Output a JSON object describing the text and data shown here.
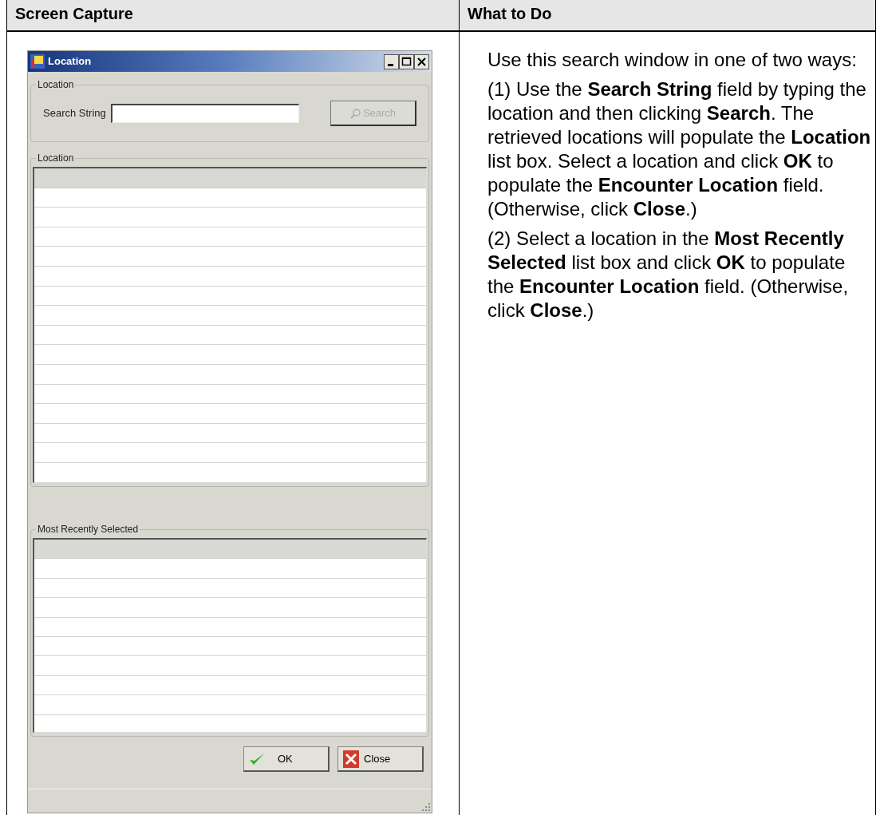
{
  "table": {
    "columns": [
      "Screen Capture",
      "What to Do"
    ]
  },
  "window": {
    "title": "Location",
    "search_group": {
      "legend": "Location",
      "label": "Search String",
      "search_button": {
        "label": "Search",
        "disabled": true
      }
    },
    "location_list": {
      "legend": "Location"
    },
    "recent_list": {
      "legend": "Most Recently Selected"
    },
    "buttons": [
      {
        "label": "OK",
        "kind": "ok"
      },
      {
        "label": "Close",
        "kind": "close"
      }
    ]
  },
  "instructions": [
    "Use this search window in one of two ways:",
    "(1) Use the **Search String** field by typing the location and then clicking **Search**. The retrieved locations will populate the **Location** list box. Select a location and click **OK** to populate the **Encounter Location** field. (Otherwise, click **Close**.)",
    "(2) Select a location in the **Most Recently Selected** list box and click **OK** to populate the **Encounter Location** field. (Otherwise, click **Close**.)"
  ]
}
